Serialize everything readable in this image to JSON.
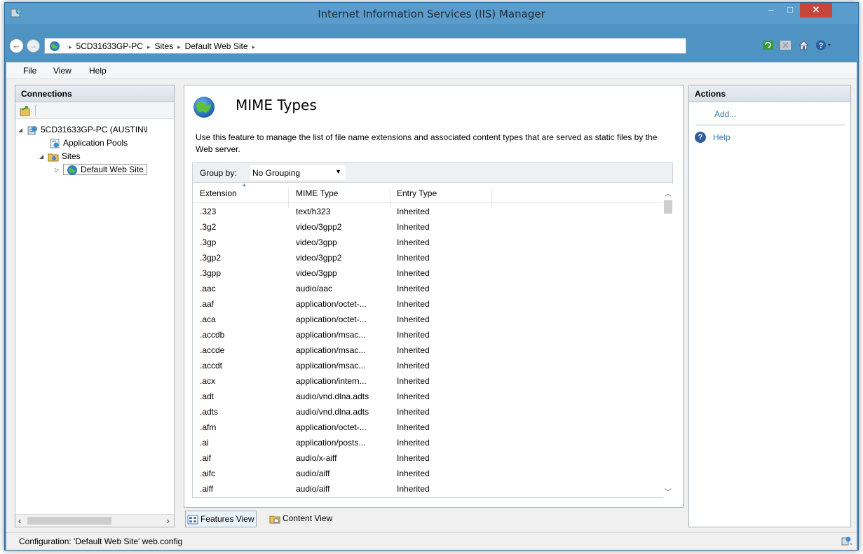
{
  "window": {
    "title": "Internet Information Services (IIS) Manager",
    "min_glyph": "–",
    "max_glyph": "□",
    "close_glyph": "✕"
  },
  "navigation": {
    "back_glyph": "←",
    "forward_glyph": "→",
    "breadcrumb": [
      "5CD31633GP-PC",
      "Sites",
      "Default Web Site"
    ],
    "separator": "▸"
  },
  "menu": {
    "file": "File",
    "view": "View",
    "help": "Help"
  },
  "connections": {
    "header": "Connections",
    "tree": {
      "server": "5CD31633GP-PC (AUSTIN\\l",
      "app_pools": "Application Pools",
      "sites": "Sites",
      "default_site": "Default Web Site"
    }
  },
  "feature": {
    "title": "MIME Types",
    "description": "Use this feature to manage the list of file name extensions and associated content types that are served as static files by the Web server.",
    "group_by_label": "Group by:",
    "group_by_value": "No Grouping",
    "columns": {
      "extension": "Extension",
      "mime_type": "MIME Type",
      "entry_type": "Entry Type"
    },
    "rows": [
      {
        "ext": ".323",
        "mime": "text/h323",
        "entry": "Inherited"
      },
      {
        "ext": ".3g2",
        "mime": "video/3gpp2",
        "entry": "Inherited"
      },
      {
        "ext": ".3gp",
        "mime": "video/3gpp",
        "entry": "Inherited"
      },
      {
        "ext": ".3gp2",
        "mime": "video/3gpp2",
        "entry": "Inherited"
      },
      {
        "ext": ".3gpp",
        "mime": "video/3gpp",
        "entry": "Inherited"
      },
      {
        "ext": ".aac",
        "mime": "audio/aac",
        "entry": "Inherited"
      },
      {
        "ext": ".aaf",
        "mime": "application/octet-...",
        "entry": "Inherited"
      },
      {
        "ext": ".aca",
        "mime": "application/octet-...",
        "entry": "Inherited"
      },
      {
        "ext": ".accdb",
        "mime": "application/msac...",
        "entry": "Inherited"
      },
      {
        "ext": ".accde",
        "mime": "application/msac...",
        "entry": "Inherited"
      },
      {
        "ext": ".accdt",
        "mime": "application/msac...",
        "entry": "Inherited"
      },
      {
        "ext": ".acx",
        "mime": "application/intern...",
        "entry": "Inherited"
      },
      {
        "ext": ".adt",
        "mime": "audio/vnd.dlna.adts",
        "entry": "Inherited"
      },
      {
        "ext": ".adts",
        "mime": "audio/vnd.dlna.adts",
        "entry": "Inherited"
      },
      {
        "ext": ".afm",
        "mime": "application/octet-...",
        "entry": "Inherited"
      },
      {
        "ext": ".ai",
        "mime": "application/posts...",
        "entry": "Inherited"
      },
      {
        "ext": ".aif",
        "mime": "audio/x-aiff",
        "entry": "Inherited"
      },
      {
        "ext": ".aifc",
        "mime": "audio/aiff",
        "entry": "Inherited"
      },
      {
        "ext": ".aiff",
        "mime": "audio/aiff",
        "entry": "Inherited"
      }
    ]
  },
  "view_tabs": {
    "features": "Features View",
    "content": "Content View"
  },
  "actions": {
    "header": "Actions",
    "add": "Add...",
    "help": "Help"
  },
  "status": {
    "text": "Configuration: 'Default Web Site' web.config"
  },
  "colors": {
    "titlebar": "#5a9ccb",
    "close_button": "#c7453a",
    "link": "#3478b6"
  }
}
